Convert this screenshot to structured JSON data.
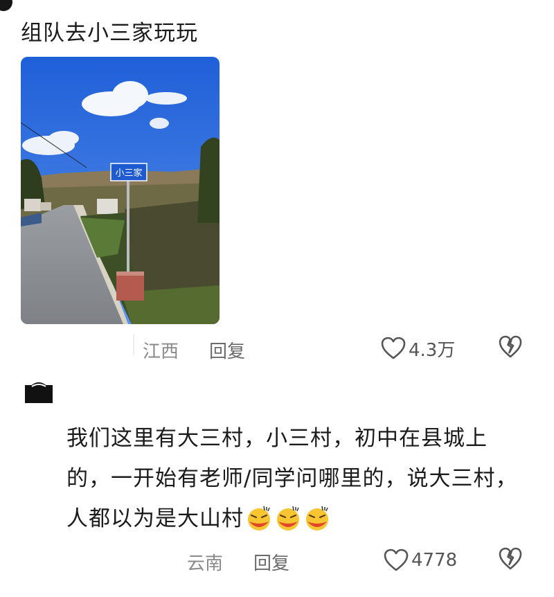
{
  "comment1": {
    "text": "组队去小三家玩玩",
    "sign_text": "小三家",
    "location": "江西",
    "reply_label": "回复",
    "like_count": "4.3万"
  },
  "comment2": {
    "text": "我们这里有大三村，小三村，初中在县城上的，一开始有老师/同学问哪里的，说大三村，人都以为是大山村",
    "emojis": [
      "laughing-emoji",
      "laughing-emoji",
      "laughing-emoji"
    ],
    "location": "云南",
    "reply_label": "回复",
    "like_count": "4778"
  },
  "colors": {
    "sky": "#2f6fe0",
    "sign": "#1e5bd0",
    "meta_text": "#8a8a8a"
  }
}
